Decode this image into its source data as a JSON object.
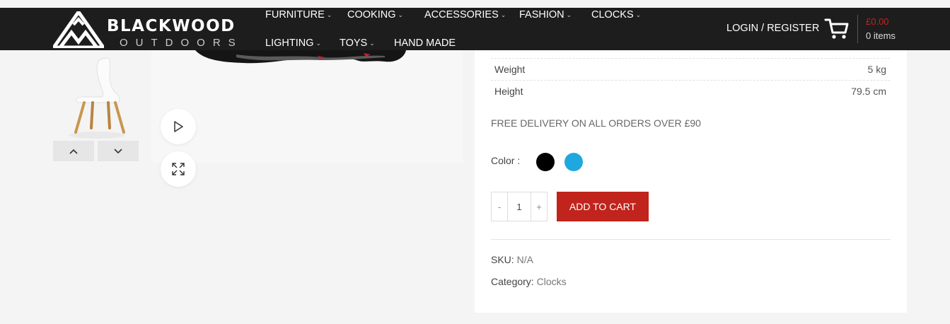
{
  "brand": {
    "name": "BLACKWOOD",
    "tagline": "OUTDOORS"
  },
  "nav": [
    {
      "label": "FURNITURE",
      "has_dropdown": true
    },
    {
      "label": "COOKING",
      "has_dropdown": true
    },
    {
      "label": "ACCESSORIES",
      "has_dropdown": true
    },
    {
      "label": "FASHION",
      "has_dropdown": true
    },
    {
      "label": "CLOCKS",
      "has_dropdown": true
    },
    {
      "label": "LIGHTING",
      "has_dropdown": true
    },
    {
      "label": "TOYS",
      "has_dropdown": true
    },
    {
      "label": "HAND MADE",
      "has_dropdown": false
    }
  ],
  "account": {
    "login_label": "LOGIN / REGISTER"
  },
  "cart": {
    "amount": "£0.00",
    "items": "0 items",
    "icon": "cart-icon"
  },
  "gallery": {
    "thumb_icon": "chair-image",
    "prev_icon": "chevron-up-icon",
    "next_icon": "chevron-down-icon",
    "video_icon": "play-icon",
    "zoom_icon": "expand-icon"
  },
  "product": {
    "attributes": [
      {
        "label": "Weight",
        "value": "5 kg"
      },
      {
        "label": "Height",
        "value": "79.5 cm"
      }
    ],
    "delivery_note": "FREE DELIVERY ON ALL ORDERS OVER £90",
    "color_label": "Color :",
    "colors": [
      {
        "name": "black",
        "hex": "#000000"
      },
      {
        "name": "blue",
        "hex": "#1fa8e0"
      }
    ],
    "quantity": {
      "minus": "-",
      "value": "1",
      "plus": "+"
    },
    "add_to_cart": "ADD TO CART",
    "sku_label": "SKU:",
    "sku_value": "N/A",
    "category_label": "Category:",
    "category_value": "Clocks"
  },
  "colors": {
    "header_bg": "#1d1d1d",
    "accent": "#c0241c",
    "page_bg": "#f4f4f4"
  }
}
